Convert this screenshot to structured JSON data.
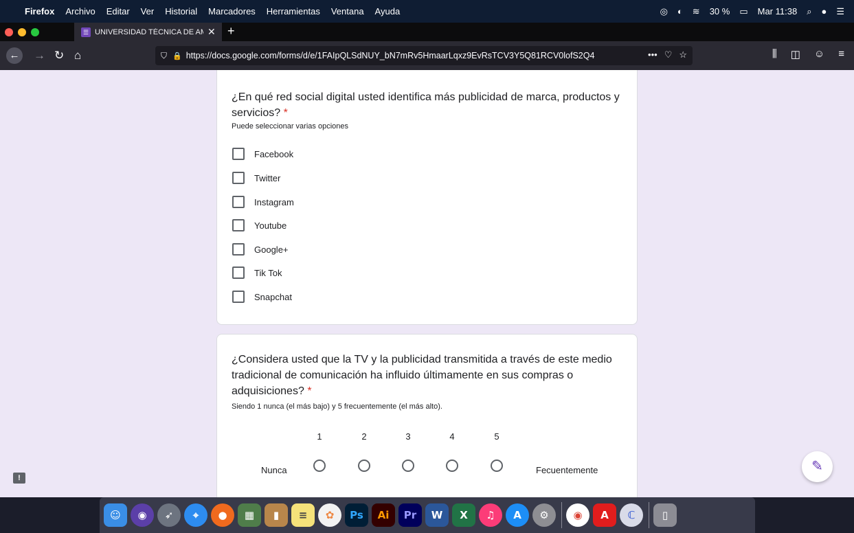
{
  "menubar": {
    "apple": "",
    "items": [
      "Firefox",
      "Archivo",
      "Editar",
      "Ver",
      "Historial",
      "Marcadores",
      "Herramientas",
      "Ventana",
      "Ayuda"
    ],
    "battery": "30 %",
    "clock": "Mar 11:38"
  },
  "browser": {
    "tab_title": "UNIVERSIDAD TÉCNICA DE AM",
    "new_tab": "+",
    "url": "https://docs.google.com/forms/d/e/1FAIpQLSdNUY_bN7mRv5HmaarLqxz9EvRsTCV3Y5Q81RCV0lofS2Q4",
    "more": "•••"
  },
  "question1": {
    "title": "¿En qué red social digital usted identifica más publicidad de marca, productos y servicios?",
    "required": "*",
    "help": "Puede seleccionar varias opciones",
    "options": [
      "Facebook",
      "Twitter",
      "Instagram",
      "Youtube",
      "Google+",
      "Tik Tok",
      "Snapchat"
    ]
  },
  "question2": {
    "title": "¿Considera usted que la TV y la publicidad transmitida a través de este medio tradicional de comunicación ha influido últimamente en sus compras o adquisiciones?",
    "required": "*",
    "help": "Siendo 1 nunca (el más bajo) y 5 frecuentemente (el más alto).",
    "scale": [
      "1",
      "2",
      "3",
      "4",
      "5"
    ],
    "low_label": "Nunca",
    "high_label": "Fecuentemente"
  },
  "dock": {
    "ps": "Ps",
    "ai": "Ai",
    "pr": "Pr",
    "word": "W",
    "excel": "X"
  },
  "colors": {
    "page_bg": "#ede7f6",
    "accent": "#673ab7",
    "required": "#d93025"
  }
}
